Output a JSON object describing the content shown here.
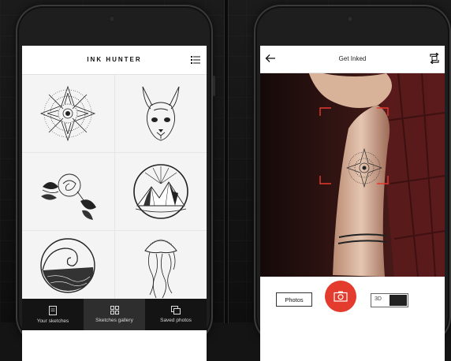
{
  "left_app": {
    "title": "INK HUNTER",
    "sketches": [
      {
        "name": "mandala sketch"
      },
      {
        "name": "sphynx cat sketch"
      },
      {
        "name": "rose sketch"
      },
      {
        "name": "mountain circle sketch"
      },
      {
        "name": "wave circle sketch"
      },
      {
        "name": "jellyfish sketch"
      }
    ],
    "nav": [
      {
        "label": "Your sketches",
        "icon": "sketch-icon",
        "active": false
      },
      {
        "label": "Sketches gallery",
        "icon": "grid-icon",
        "active": true
      },
      {
        "label": "Saved photos",
        "icon": "photos-icon",
        "active": false
      }
    ]
  },
  "right_app": {
    "title": "Get Inked",
    "photos_button": "Photos",
    "toggle_label": "3D",
    "accent": "#e33b2e"
  }
}
